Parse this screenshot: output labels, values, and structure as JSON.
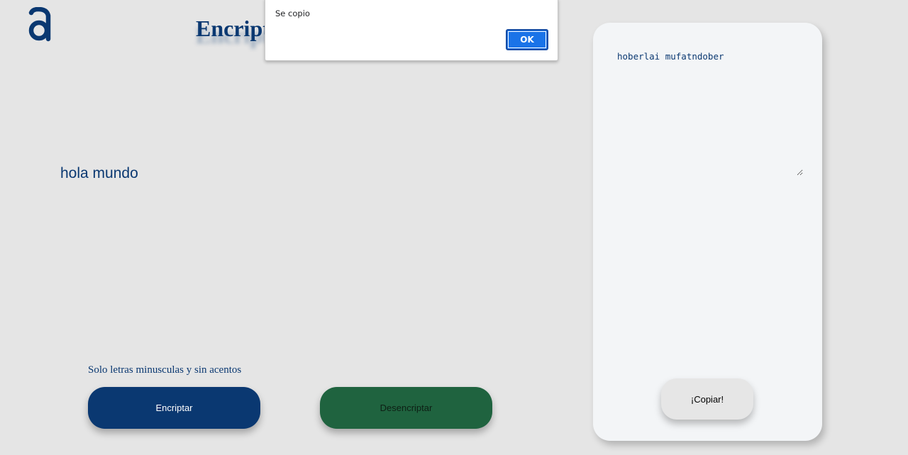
{
  "header": {
    "logo_icon": "alura-a-logo-icon",
    "title": "Encript"
  },
  "input": {
    "value": "hola mundo"
  },
  "hint": "Solo letras minusculas y sin acentos",
  "buttons": {
    "encrypt_label": "Encriptar",
    "decrypt_label": "Desencriptar"
  },
  "output": {
    "value": "hoberlai mufatndober",
    "copy_label": "¡Copiar!"
  },
  "alert": {
    "message": "Se copio",
    "ok_label": "OK"
  },
  "colors": {
    "background": "#e5e5e5",
    "primary": "#0a3871",
    "secondary": "#1f633f",
    "card": "#f3f5f7",
    "alert_button": "#1a73e8"
  }
}
